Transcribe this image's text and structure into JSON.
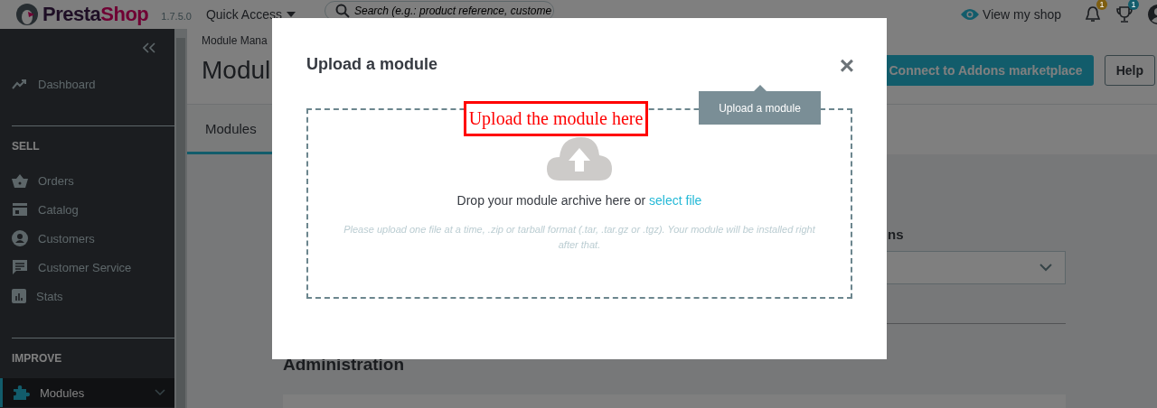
{
  "header": {
    "logo": [
      "Presta",
      "Shop"
    ],
    "version": "1.7.5.0",
    "quick_access": "Quick Access",
    "search": {
      "placeholder": "Search (e.g.: product reference, custome"
    },
    "view_shop": "View my shop",
    "notifications": [
      {
        "kind": "bell",
        "count": "1",
        "color": "#7e5e11"
      },
      {
        "kind": "trophy",
        "count": "1",
        "color": "#135d6c"
      }
    ]
  },
  "sidebar": {
    "top": [
      {
        "label": "Dashboard",
        "selected": false
      }
    ],
    "sections": [
      {
        "title": "SELL",
        "items": [
          {
            "label": "Orders",
            "selected": false
          },
          {
            "label": "Catalog",
            "selected": false
          },
          {
            "label": "Customers",
            "selected": false
          },
          {
            "label": "Customer Service",
            "selected": false
          },
          {
            "label": "Stats",
            "selected": false
          }
        ]
      },
      {
        "title": "IMPROVE",
        "items": [
          {
            "label": "Modules",
            "selected": true,
            "expanded": false
          }
        ]
      }
    ]
  },
  "page": {
    "breadcrumb": "Module Mana",
    "title": "Modul",
    "buttons": [
      {
        "kind": "primary",
        "label": "Connect to Addons marketplace"
      },
      {
        "kind": "outline",
        "label": "Help"
      }
    ],
    "tabs": [
      {
        "label": "Modules",
        "selected": true
      }
    ],
    "filter_label": "ns",
    "section_title": "Administration"
  },
  "modal": {
    "title": "Upload a module",
    "close": "×",
    "tooltip": "Upload a module",
    "annotation": "Upload the module here",
    "drop_text": "Drop your module archive here or ",
    "drop_link": "select file",
    "hint": "Please upload one file at a time, .zip or tarball format (.tar, .tar.gz or .tgz). Your module will be installed right after that."
  }
}
